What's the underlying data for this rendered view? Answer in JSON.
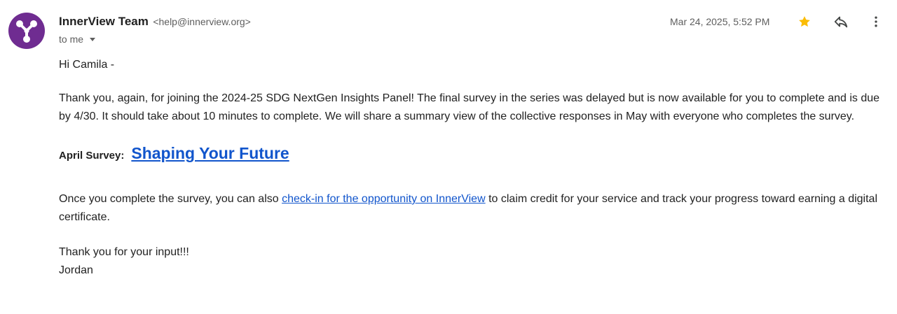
{
  "sender": {
    "name": "InnerView Team",
    "email": "<help@innerview.org>",
    "avatar_color": "#6f2c91"
  },
  "recipient": {
    "label": "to me"
  },
  "timestamp": "Mar 24, 2025, 5:52 PM",
  "actions": {
    "star_icon": "star-icon",
    "star_color": "#fbbc04",
    "reply_icon": "reply-icon",
    "more_icon": "more-vertical-icon"
  },
  "message": {
    "greeting": "Hi Camila -",
    "paragraph1": "Thank you, again, for joining the 2024-25 SDG NextGen Insights Panel! The final survey in the series was delayed but is now available for you to complete and is due by 4/30. It should take about 10 minutes to complete. We will share a summary view of the collective responses in May with everyone who completes the survey.",
    "survey_label": "April Survey:",
    "survey_link": "Shaping Your Future",
    "paragraph2_before": "Once you complete the survey, you can also ",
    "paragraph2_link": "check-in for the opportunity on InnerView",
    "paragraph2_after": " to claim credit for your service and track your progress toward earning a digital certificate.",
    "closing": "Thank you for your input!!!",
    "signature": "Jordan"
  },
  "colors": {
    "link": "#1155cc",
    "muted_text": "#5e5e5e"
  }
}
